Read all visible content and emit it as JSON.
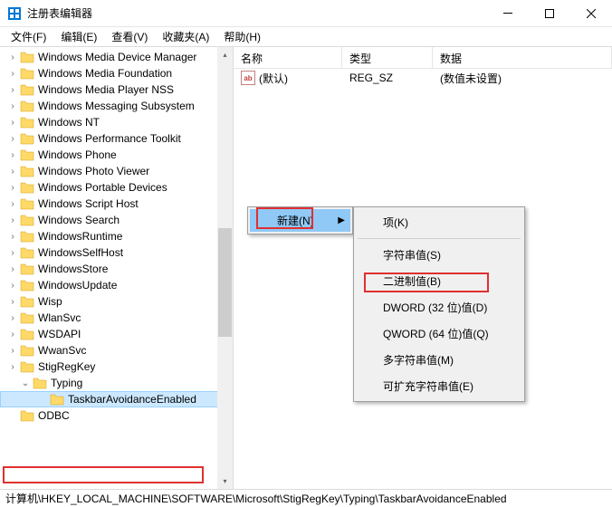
{
  "window": {
    "title": "注册表编辑器"
  },
  "menubar": [
    {
      "label": "文件(F)"
    },
    {
      "label": "编辑(E)"
    },
    {
      "label": "查看(V)"
    },
    {
      "label": "收藏夹(A)"
    },
    {
      "label": "帮助(H)"
    }
  ],
  "tree": {
    "items": [
      {
        "label": "Windows Media Device Manager"
      },
      {
        "label": "Windows Media Foundation"
      },
      {
        "label": "Windows Media Player NSS"
      },
      {
        "label": "Windows Messaging Subsystem"
      },
      {
        "label": "Windows NT"
      },
      {
        "label": "Windows Performance Toolkit"
      },
      {
        "label": "Windows Phone"
      },
      {
        "label": "Windows Photo Viewer"
      },
      {
        "label": "Windows Portable Devices"
      },
      {
        "label": "Windows Script Host"
      },
      {
        "label": "Windows Search"
      },
      {
        "label": "WindowsRuntime"
      },
      {
        "label": "WindowsSelfHost"
      },
      {
        "label": "WindowsStore"
      },
      {
        "label": "WindowsUpdate"
      },
      {
        "label": "Wisp"
      },
      {
        "label": "WlanSvc"
      },
      {
        "label": "WSDAPI"
      },
      {
        "label": "WwanSvc"
      },
      {
        "label": "StigRegKey"
      },
      {
        "label": "Typing",
        "expanded": true,
        "indent": 1
      },
      {
        "label": "TaskbarAvoidanceEnabled",
        "selected": true,
        "indent": 2
      },
      {
        "label": "ODBC",
        "noexpand": true
      }
    ]
  },
  "list": {
    "headers": {
      "name": "名称",
      "type": "类型",
      "data": "数据"
    },
    "rows": [
      {
        "name": "(默认)",
        "type": "REG_SZ",
        "data": "(数值未设置)"
      }
    ]
  },
  "context_menu": {
    "new_label": "新建(N)"
  },
  "submenu": {
    "key": "项(K)",
    "string": "字符串值(S)",
    "binary": "二进制值(B)",
    "dword": "DWORD (32 位)值(D)",
    "qword": "QWORD (64 位)值(Q)",
    "multi": "多字符串值(M)",
    "expand": "可扩充字符串值(E)"
  },
  "statusbar": {
    "path": "计算机\\HKEY_LOCAL_MACHINE\\SOFTWARE\\Microsoft\\StigRegKey\\Typing\\TaskbarAvoidanceEnabled"
  },
  "icons": {
    "ab": "ab"
  }
}
